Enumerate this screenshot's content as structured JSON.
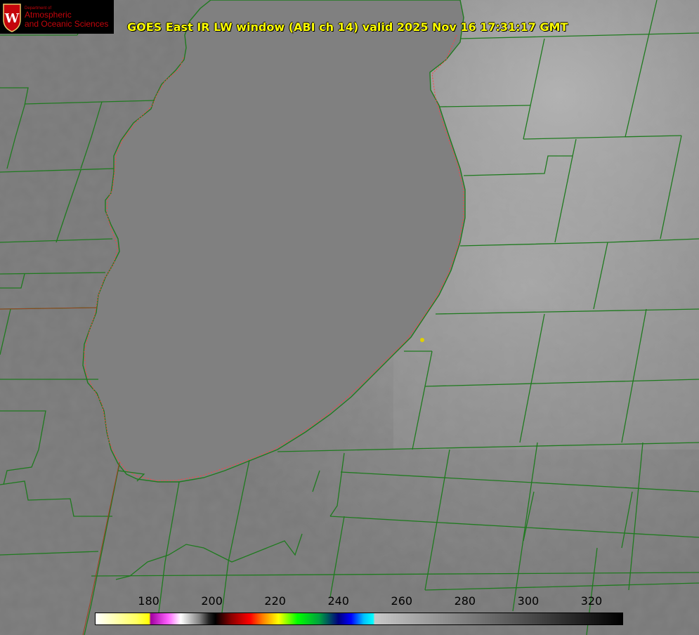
{
  "title": "GOES East IR LW window (ABI ch 14) valid 2025 Nov 16 17:31:17 GMT",
  "logo": {
    "department": "Department of",
    "line1": "Atmospheric",
    "line2": "and Oceanic Sciences",
    "mark": "W"
  },
  "colorbar": {
    "ticks": [
      "180",
      "200",
      "220",
      "240",
      "260",
      "280",
      "300",
      "320"
    ],
    "tick_values": [
      180,
      200,
      220,
      240,
      260,
      280,
      300,
      320
    ],
    "range": [
      163,
      330
    ]
  },
  "colors": {
    "lake": "#808080",
    "land_dark": "#777777",
    "cloud_light": "#a6a6a6",
    "county_lines": "#1f7a1f",
    "coastline_dotted": "#ff4040",
    "title": "#ffff00",
    "marker": "#e0d000",
    "logo_red": "#c5050c"
  },
  "map": {
    "features": [
      "lake-michigan",
      "county-boundaries",
      "state-boundary",
      "coastline"
    ]
  }
}
